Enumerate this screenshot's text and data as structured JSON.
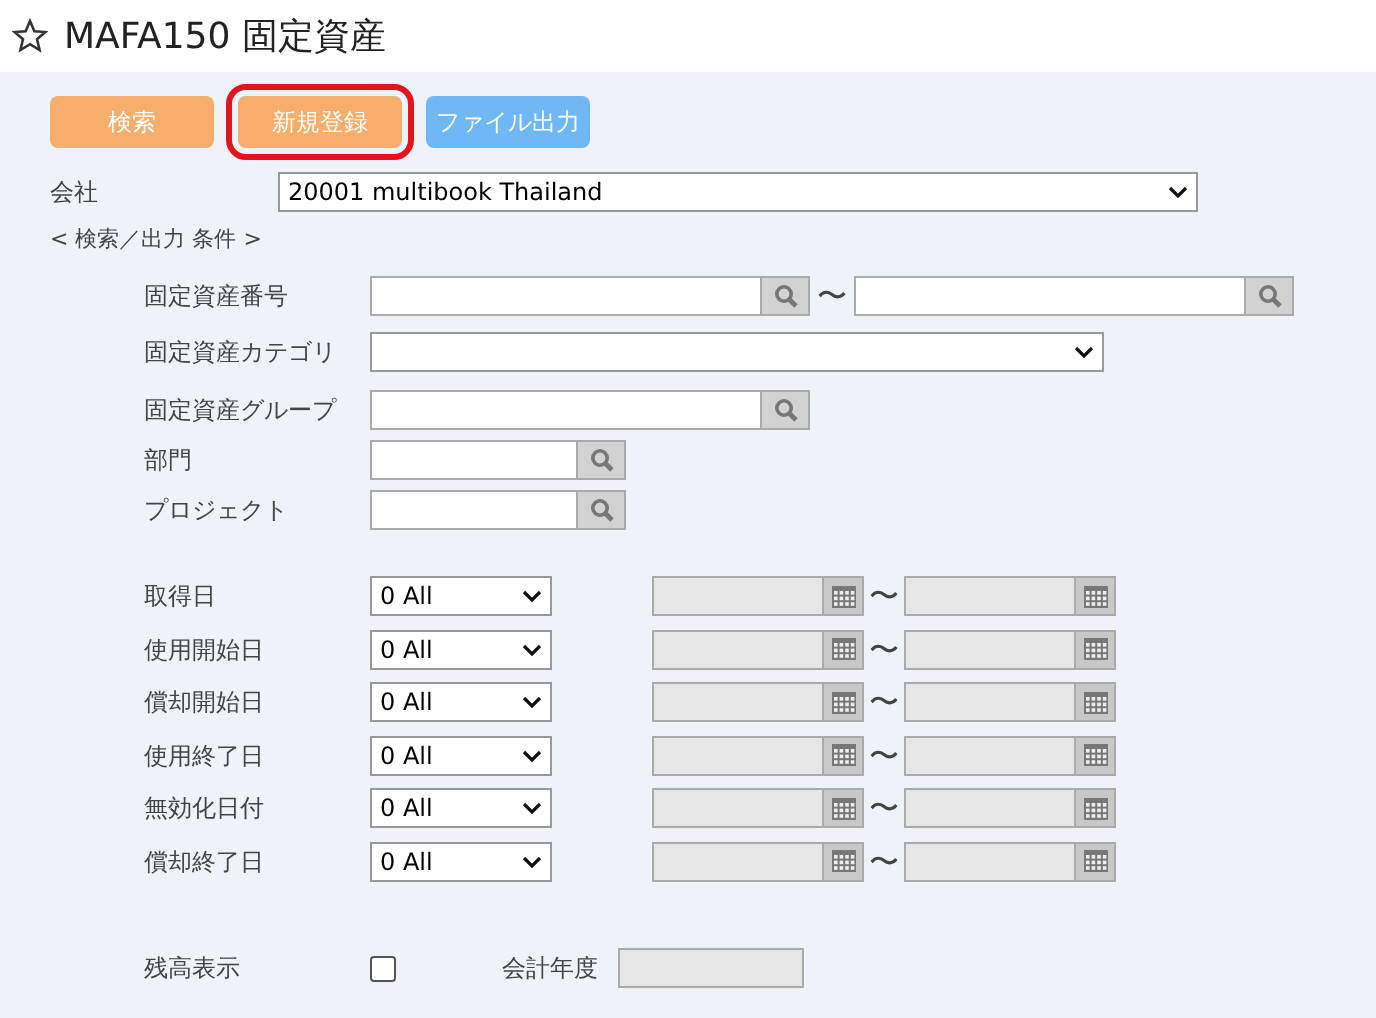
{
  "title": "MAFA150 固定資産",
  "buttons": [
    {
      "label": "検索",
      "color": "#f7ae6a",
      "highlighted": false
    },
    {
      "label": "新規登録",
      "color": "#f7ae6a",
      "highlighted": true
    },
    {
      "label": "ファイル出力",
      "color": "#6fb7f5",
      "highlighted": false
    }
  ],
  "company": {
    "label": "会社",
    "value": "20001 multibook Thailand"
  },
  "conditions_label": "< 検索／出力 条件 >",
  "search_fields": [
    {
      "label": "固定資産番号",
      "kind": "range_lookup",
      "range_mark": "〜"
    },
    {
      "label": "固定資産カテゴリ",
      "kind": "select"
    },
    {
      "label": "固定資産グループ",
      "kind": "lookup"
    },
    {
      "label": "部門",
      "kind": "short_lookup"
    },
    {
      "label": "プロジェクト",
      "kind": "short_lookup"
    }
  ],
  "date_filters": [
    {
      "label": "取得日",
      "value": "0 All",
      "range_mark": "〜",
      "disabled": true
    },
    {
      "label": "使用開始日",
      "value": "0 All",
      "range_mark": "〜",
      "disabled": true
    },
    {
      "label": "償却開始日",
      "value": "0 All",
      "range_mark": "〜",
      "disabled": true
    },
    {
      "label": "使用終了日",
      "value": "0 All",
      "range_mark": "〜",
      "disabled": true
    },
    {
      "label": "無効化日付",
      "value": "0 All",
      "range_mark": "〜",
      "disabled": true
    },
    {
      "label": "償却終了日",
      "value": "0 All",
      "range_mark": "〜",
      "disabled": true
    }
  ],
  "balance": {
    "label": "残高表示",
    "checked": false
  },
  "fiscal_year": {
    "label": "会計年度",
    "disabled": true
  }
}
